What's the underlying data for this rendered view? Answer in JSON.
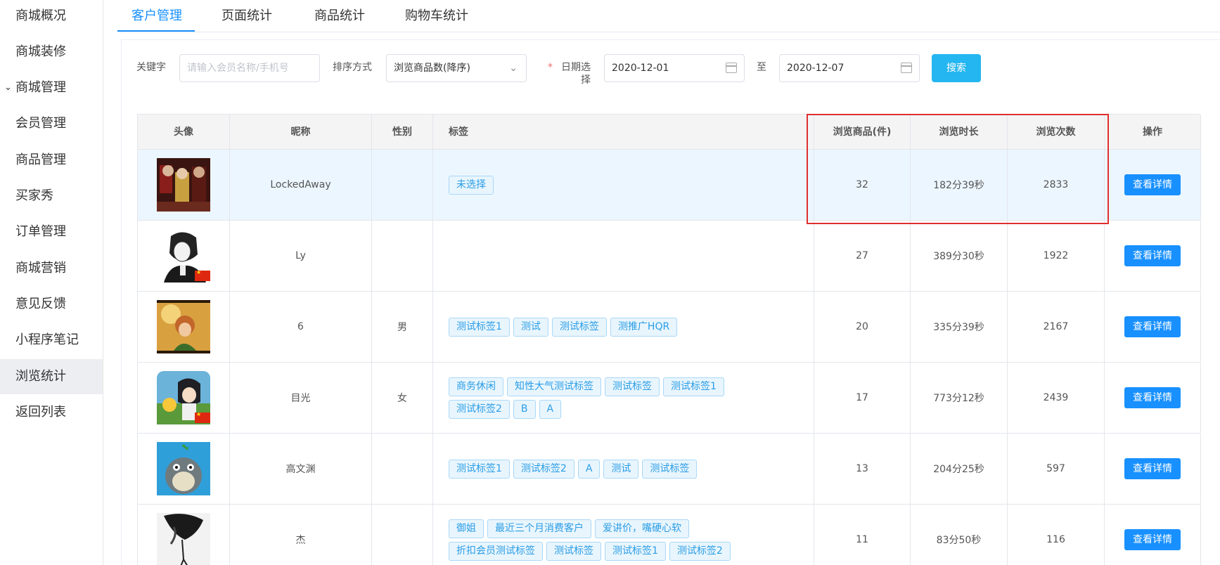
{
  "sidebar": {
    "items": [
      {
        "label": "商城概况"
      },
      {
        "label": "商城装修"
      },
      {
        "label": "商城管理",
        "chevron": "chevron-down-icon"
      },
      {
        "label": "会员管理"
      },
      {
        "label": "商品管理"
      },
      {
        "label": "买家秀"
      },
      {
        "label": "订单管理"
      },
      {
        "label": "商城营销"
      },
      {
        "label": "意见反馈"
      },
      {
        "label": "小程序笔记"
      },
      {
        "label": "浏览统计",
        "active": true
      },
      {
        "label": "返回列表"
      }
    ]
  },
  "tabs": [
    {
      "label": "客户管理",
      "active": true
    },
    {
      "label": "页面统计"
    },
    {
      "label": "商品统计"
    },
    {
      "label": "购物车统计"
    }
  ],
  "filters": {
    "keyword_label": "关键字",
    "keyword_placeholder": "请输入会员名称/手机号",
    "keyword_value": "",
    "sort_label": "排序方式",
    "sort_value": "浏览商品数(降序)",
    "date_required_mark": "*",
    "date_label_line1": "日期选",
    "date_label_line2": "择",
    "date_from": "2020-12-01",
    "date_sep": "至",
    "date_to": "2020-12-07",
    "search_label": "搜索"
  },
  "table": {
    "headers": [
      "头像",
      "昵称",
      "性别",
      "标签",
      "浏览商品(件)",
      "浏览时长",
      "浏览次数",
      "操作"
    ],
    "action_label": "查看详情",
    "rows": [
      {
        "avatar": "avatar-anime-group",
        "nickname": "LockedAway",
        "gender": "",
        "tags": [
          "未选择"
        ],
        "items": "32",
        "duration": "182分39秒",
        "visits": "2833"
      },
      {
        "avatar": "avatar-manga-boy",
        "nickname": "Ly",
        "gender": "",
        "tags": [],
        "items": "27",
        "duration": "389分30秒",
        "visits": "1922"
      },
      {
        "avatar": "avatar-cartoon-girl",
        "nickname": "6",
        "gender": "男",
        "tags": [
          "测试标签1",
          "测试",
          "测试标签",
          "测推广HQR"
        ],
        "items": "20",
        "duration": "335分39秒",
        "visits": "2167"
      },
      {
        "avatar": "avatar-anime-girl",
        "nickname": "目光",
        "gender": "女",
        "tags": [
          "商务休闲",
          "知性大气测试标签",
          "测试标签",
          "测试标签1",
          "测试标签2",
          "B",
          "A"
        ],
        "items": "17",
        "duration": "773分12秒",
        "visits": "2439"
      },
      {
        "avatar": "avatar-totoro",
        "nickname": "高文渊",
        "gender": "",
        "tags": [
          "测试标签1",
          "测试标签2",
          "A",
          "测试",
          "测试标签"
        ],
        "items": "13",
        "duration": "204分25秒",
        "visits": "597"
      },
      {
        "avatar": "avatar-ink-figure",
        "nickname": "杰",
        "gender": "",
        "tags": [
          "御姐",
          "最近三个月消费客户",
          "爱讲价，嘴硬心软",
          "折扣会员测试标签",
          "测试标签",
          "测试标签1",
          "测试标签2"
        ],
        "items": "11",
        "duration": "83分50秒",
        "visits": "116"
      }
    ]
  },
  "colors": {
    "accent": "#1890ff",
    "search_button": "#24b6f0",
    "highlight_box": "#e02f2f",
    "tag_text": "#2a9de6"
  }
}
